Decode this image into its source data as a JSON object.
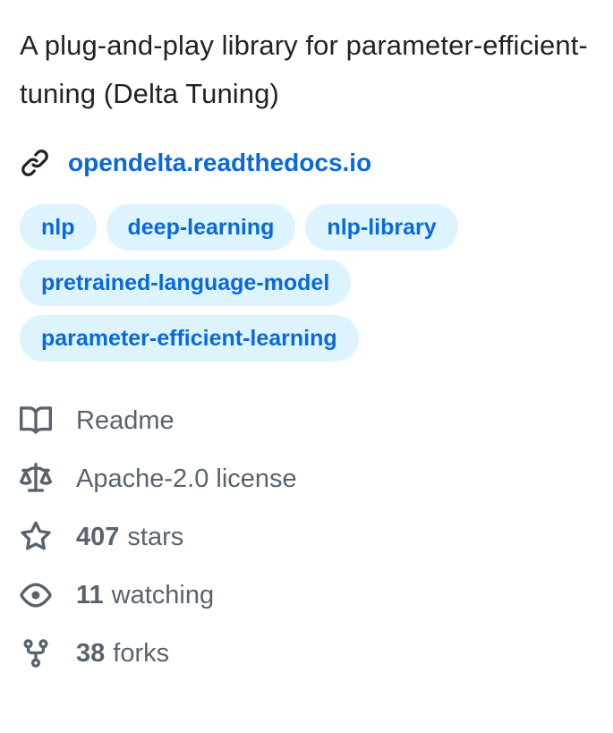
{
  "about": {
    "description": "A plug-and-play library for parameter-efficient-tuning (Delta Tuning)",
    "homepage": {
      "icon": "link-icon",
      "label": "opendelta.readthedocs.io"
    },
    "topics": [
      "nlp",
      "deep-learning",
      "nlp-library",
      "pretrained-language-model",
      "parameter-efficient-learning"
    ],
    "meta": {
      "readme": {
        "icon": "book-icon",
        "label": "Readme"
      },
      "license": {
        "icon": "law-icon",
        "label": "Apache-2.0 license"
      },
      "stars": {
        "icon": "star-icon",
        "count": "407",
        "label": "stars"
      },
      "watching": {
        "icon": "eye-icon",
        "count": "11",
        "label": "watching"
      },
      "forks": {
        "icon": "repo-forked-icon",
        "count": "38",
        "label": "forks"
      }
    }
  },
  "colors": {
    "text": "#1f2328",
    "muted": "#59636e",
    "link": "#0969da",
    "topic_bg": "#ddf4ff"
  }
}
